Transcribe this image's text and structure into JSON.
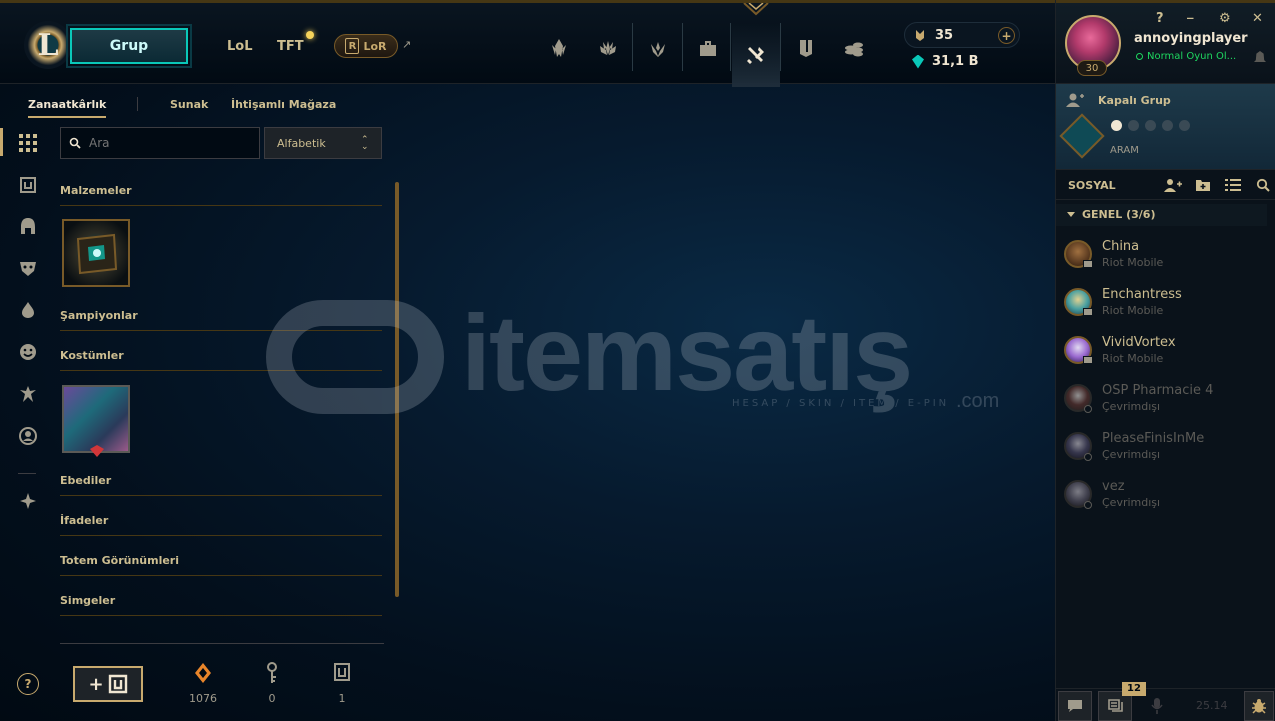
{
  "top": {
    "play_button": "Grup",
    "game_tabs": [
      "LoL",
      "TFT"
    ],
    "lor_label": "LoR",
    "lor_letter": "R",
    "rp": "35",
    "be": "31,1 B"
  },
  "nav_icons": [
    "home-icon",
    "tft-icon",
    "clash-icon",
    "collection-icon",
    "loot-icon",
    "profile-icon",
    "store-icon"
  ],
  "window": {
    "help": "?",
    "minimize": "_",
    "settings": "⚙",
    "close": "✕"
  },
  "profile": {
    "username": "annoyingplayer",
    "status": "Normal Oyun Ol...",
    "level": "30"
  },
  "lobby": {
    "title": "Kapalı Grup",
    "mode": "ARAM"
  },
  "social": {
    "title": "SOSYAL",
    "group": "GENEL (3/6)",
    "friends": [
      {
        "name": "China",
        "status": "Riot Mobile"
      },
      {
        "name": "Enchantress",
        "status": "Riot Mobile"
      },
      {
        "name": "VividVortex",
        "status": "Riot Mobile"
      },
      {
        "name": "OSP Pharmacie 4",
        "status": "Çevrimdışı"
      },
      {
        "name": "PleaseFinisInMe",
        "status": "Çevrimdışı"
      },
      {
        "name": "vez",
        "status": "Çevrimdışı"
      }
    ]
  },
  "dock": {
    "badge": "12",
    "version": "25.14"
  },
  "subnav": [
    "Zanaatkârlık",
    "Sunak",
    "İhtişamlı Mağaza"
  ],
  "search": {
    "placeholder": "Ara"
  },
  "sort": {
    "value": "Alfabetik",
    "arrows": "⌃⌄"
  },
  "sections": [
    "Malzemeler",
    "Şampiyonlar",
    "Kostümler",
    "Ebediler",
    "İfadeler",
    "Totem Görünümleri",
    "Simgeler"
  ],
  "stats": {
    "essence": "1076",
    "keys": "0",
    "chests": "1"
  },
  "craft_label": "+",
  "help_label": "?",
  "watermark": {
    "text": "itemsatış",
    "sub": "HESAP / SKIN / ITEM / E-PIN",
    "domain": ".com"
  },
  "colors": {
    "gold": "#c8aa6e",
    "teal": "#0ac8b9",
    "bg": "#010a13"
  }
}
